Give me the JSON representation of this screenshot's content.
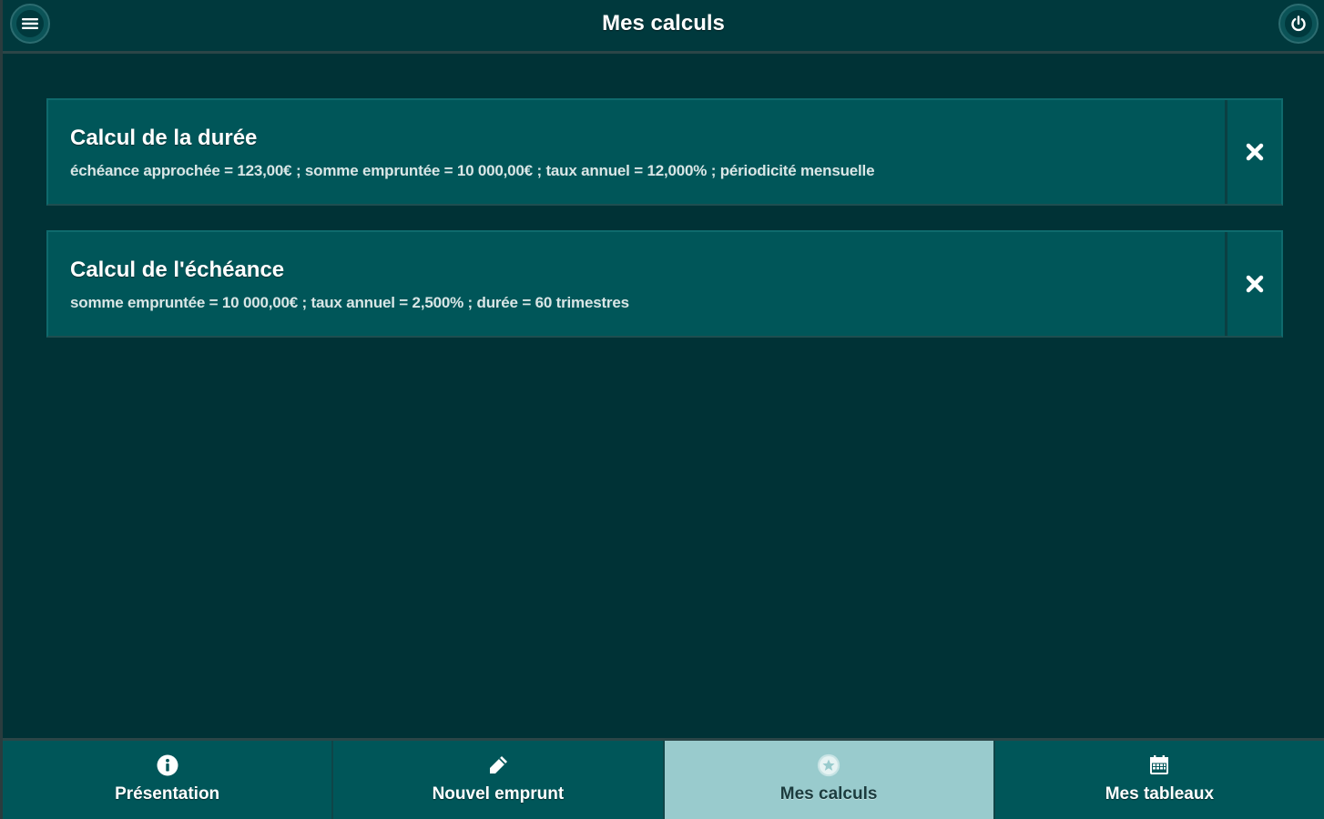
{
  "header": {
    "title": "Mes calculs",
    "menu_icon": "hamburger-menu-icon",
    "power_icon": "power-icon"
  },
  "calculations": [
    {
      "title": "Calcul de la durée",
      "details": "échéance approchée = 123,00€ ; somme empruntée = 10 000,00€ ; taux annuel = 12,000% ; périodicité mensuelle",
      "delete_icon": "close-icon"
    },
    {
      "title": "Calcul de l'échéance",
      "details": "somme empruntée = 10 000,00€ ; taux annuel = 2,500% ; durée = 60 trimestres",
      "delete_icon": "close-icon"
    }
  ],
  "nav": {
    "tabs": [
      {
        "label": "Présentation",
        "icon": "info-icon",
        "active": false
      },
      {
        "label": "Nouvel emprunt",
        "icon": "pencil-icon",
        "active": false
      },
      {
        "label": "Mes calculs",
        "icon": "star-icon",
        "active": true
      },
      {
        "label": "Mes tableaux",
        "icon": "calendar-icon",
        "active": false
      }
    ]
  },
  "colors": {
    "background": "#003236",
    "header": "#00393d",
    "card": "#005659",
    "active_tab": "#99cbcd"
  }
}
